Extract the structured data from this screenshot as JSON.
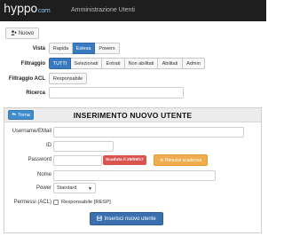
{
  "header": {
    "logo_main": "hyppo",
    "logo_suffix": "com",
    "app_title": "Amministrazione Utenti"
  },
  "toolbar": {
    "new_icon": "add-user-icon",
    "new_label": "Nuovo"
  },
  "vista": {
    "label": "Vista",
    "options": [
      "Rapida",
      "Estesa",
      "Powers"
    ],
    "selected": "Estesa"
  },
  "filtraggio": {
    "label": "Filtraggio",
    "options": [
      "TUTTI",
      "Selezionati",
      "Entrati",
      "Non abilitati",
      "Abilitati",
      "Admin"
    ],
    "selected": "TUTTI"
  },
  "filtraggio_acl": {
    "label": "Filtraggio ACL",
    "option": "Responsabile"
  },
  "ricerca": {
    "label": "Ricerca",
    "value": ""
  },
  "form": {
    "back_icon": "return-arrow-icon",
    "back_label": "Torna",
    "title": "INSERIMENTO NUOVO UTENTE",
    "fields": {
      "username_label": "Username/EMail",
      "username_value": "",
      "id_label": "ID",
      "id_value": "",
      "password_label": "Password",
      "password_value": "",
      "expiry_badge": "Scaduta il 29/09/17",
      "remove_expiry_icon": "times-icon",
      "remove_expiry_label": "Rimuovi scadenza",
      "nome_label": "Nome",
      "nome_value": "",
      "power_label": "Power",
      "power_value": "Standard",
      "permessi_label": "Permessi (ACL)",
      "permessi_checkbox_label": "Responsabile [RESP]",
      "permessi_checked": false
    },
    "submit_icon": "save-icon",
    "submit_label": "Inserisci nuovo utente"
  },
  "colors": {
    "topbar": "#1e1e1e",
    "primary": "#3a7ac0",
    "info": "#3f8dcc",
    "danger": "#d9534f",
    "warning": "#f0ad4e"
  }
}
